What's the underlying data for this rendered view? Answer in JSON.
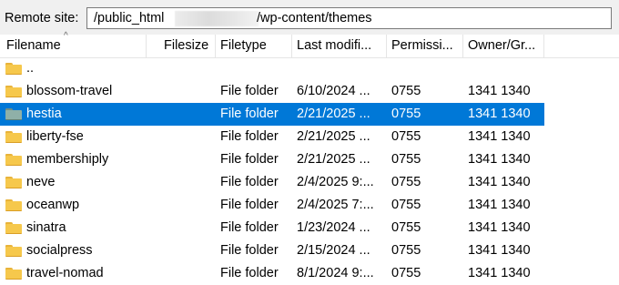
{
  "remote_site": {
    "label": "Remote site:",
    "path_start": "/public_html",
    "path_end": "/wp-content/themes"
  },
  "columns": [
    "Filename",
    "Filesize",
    "Filetype",
    "Last modifi...",
    "Permissi...",
    "Owner/Gr..."
  ],
  "rows": [
    {
      "name": "..",
      "filesize": "",
      "filetype": "",
      "modified": "",
      "permissions": "",
      "owner": ""
    },
    {
      "name": "blossom-travel",
      "filesize": "",
      "filetype": "File folder",
      "modified": "6/10/2024 ...",
      "permissions": "0755",
      "owner": "1341 1340"
    },
    {
      "name": "hestia",
      "filesize": "",
      "filetype": "File folder",
      "modified": "2/21/2025 ...",
      "permissions": "0755",
      "owner": "1341 1340"
    },
    {
      "name": "liberty-fse",
      "filesize": "",
      "filetype": "File folder",
      "modified": "2/21/2025 ...",
      "permissions": "0755",
      "owner": "1341 1340"
    },
    {
      "name": "membershiply",
      "filesize": "",
      "filetype": "File folder",
      "modified": "2/21/2025 ...",
      "permissions": "0755",
      "owner": "1341 1340"
    },
    {
      "name": "neve",
      "filesize": "",
      "filetype": "File folder",
      "modified": "2/4/2025 9:...",
      "permissions": "0755",
      "owner": "1341 1340"
    },
    {
      "name": "oceanwp",
      "filesize": "",
      "filetype": "File folder",
      "modified": "2/4/2025 7:...",
      "permissions": "0755",
      "owner": "1341 1340"
    },
    {
      "name": "sinatra",
      "filesize": "",
      "filetype": "File folder",
      "modified": "1/23/2024 ...",
      "permissions": "0755",
      "owner": "1341 1340"
    },
    {
      "name": "socialpress",
      "filesize": "",
      "filetype": "File folder",
      "modified": "2/15/2024 ...",
      "permissions": "0755",
      "owner": "1341 1340"
    },
    {
      "name": "travel-nomad",
      "filesize": "",
      "filetype": "File folder",
      "modified": "8/1/2024 9:...",
      "permissions": "0755",
      "owner": "1341 1340"
    }
  ],
  "selected_row": "hestia",
  "colors": {
    "selection": "#0078d7",
    "folder": "#f6c84c"
  }
}
